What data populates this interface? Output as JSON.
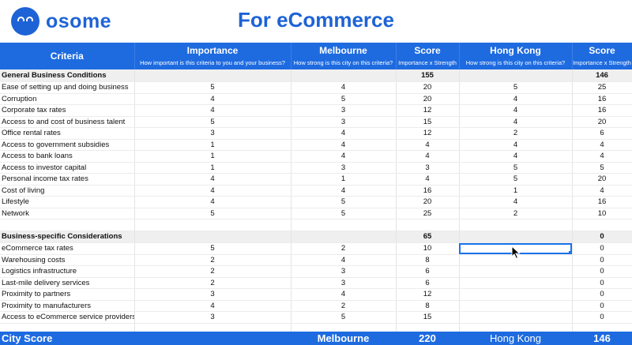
{
  "brand": {
    "name": "osome",
    "color": "#1e63d6"
  },
  "title": "For eCommerce",
  "header": {
    "criteria": "Criteria",
    "importance": "Importance",
    "importance_sub": "How important is this criteria to you and your business?",
    "melbourne": "Melbourne",
    "melbourne_sub": "How strong is this city on this criteria?",
    "score": "Score",
    "score_sub": "Importance x Strength",
    "hongkong": "Hong Kong",
    "hongkong_sub": "How strong is this city on this criteria?",
    "score2": "Score",
    "score2_sub": "Importance x Strength"
  },
  "general": {
    "label": "General Business Conditions",
    "melbourne_total": "155",
    "hongkong_total": "146",
    "rows": [
      {
        "c": "Ease of setting up and doing business",
        "i": "5",
        "m": "4",
        "ms": "20",
        "h": "5",
        "hs": "25"
      },
      {
        "c": "Corruption",
        "i": "4",
        "m": "5",
        "ms": "20",
        "h": "4",
        "hs": "16"
      },
      {
        "c": "Corporate tax rates",
        "i": "4",
        "m": "3",
        "ms": "12",
        "h": "4",
        "hs": "16"
      },
      {
        "c": "Access to and cost of business talent",
        "i": "5",
        "m": "3",
        "ms": "15",
        "h": "4",
        "hs": "20"
      },
      {
        "c": "Office rental rates",
        "i": "3",
        "m": "4",
        "ms": "12",
        "h": "2",
        "hs": "6"
      },
      {
        "c": "Access to government subsidies",
        "i": "1",
        "m": "4",
        "ms": "4",
        "h": "4",
        "hs": "4"
      },
      {
        "c": "Access to bank loans",
        "i": "1",
        "m": "4",
        "ms": "4",
        "h": "4",
        "hs": "4"
      },
      {
        "c": "Access to investor capital",
        "i": "1",
        "m": "3",
        "ms": "3",
        "h": "5",
        "hs": "5"
      },
      {
        "c": "Personal income tax rates",
        "i": "4",
        "m": "1",
        "ms": "4",
        "h": "5",
        "hs": "20"
      },
      {
        "c": "Cost of living",
        "i": "4",
        "m": "4",
        "ms": "16",
        "h": "1",
        "hs": "4"
      },
      {
        "c": "Lifestyle",
        "i": "4",
        "m": "5",
        "ms": "20",
        "h": "4",
        "hs": "16"
      },
      {
        "c": "Network",
        "i": "5",
        "m": "5",
        "ms": "25",
        "h": "2",
        "hs": "10"
      }
    ]
  },
  "specific": {
    "label": "Business-specific Considerations",
    "melbourne_total": "65",
    "hongkong_total": "0",
    "rows": [
      {
        "c": "eCommerce tax rates",
        "i": "5",
        "m": "2",
        "ms": "10",
        "h": "",
        "hs": "0"
      },
      {
        "c": "Warehousing costs",
        "i": "2",
        "m": "4",
        "ms": "8",
        "h": "",
        "hs": "0"
      },
      {
        "c": "Logistics infrastructure",
        "i": "2",
        "m": "3",
        "ms": "6",
        "h": "",
        "hs": "0"
      },
      {
        "c": "Last-mile delivery services",
        "i": "2",
        "m": "3",
        "ms": "6",
        "h": "",
        "hs": "0"
      },
      {
        "c": "Proximity to partners",
        "i": "3",
        "m": "4",
        "ms": "12",
        "h": "",
        "hs": "0"
      },
      {
        "c": "Proximity to manufacturers",
        "i": "4",
        "m": "2",
        "ms": "8",
        "h": "",
        "hs": "0"
      },
      {
        "c": "Access to eCommerce service providers",
        "i": "3",
        "m": "5",
        "ms": "15",
        "h": "",
        "hs": "0"
      }
    ]
  },
  "footer": {
    "label": "City Score",
    "melbourne": "Melbourne",
    "melbourne_score": "220",
    "hongkong": "Hong Kong",
    "hongkong_score": "146"
  }
}
